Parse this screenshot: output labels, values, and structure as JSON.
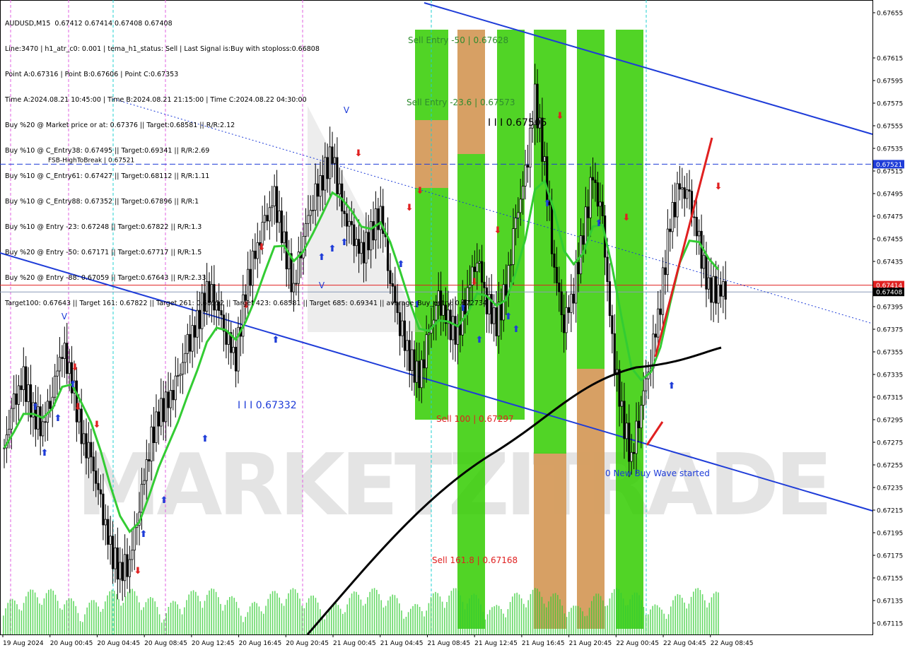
{
  "chart_data": {
    "type": "candlestick",
    "symbol": "AUDUSD,M15",
    "ohlc_header": "0.67412 0.67414 0.67408 0.67408",
    "info_lines": [
      "AUDUSD,M15  0.67412 0.67414 0.67408 0.67408",
      "Line:3470 | h1_atr_c0: 0.001 | tema_h1_status: Sell | Last Signal is:Buy with stoploss:0.66808",
      "Point A:0.67316 | Point B:0.67606 | Point C:0.67353",
      "Time A:2024.08.21 10:45:00 | Time B:2024.08.21 21:15:00 | Time C:2024.08.22 04:30:00",
      "Buy %20 @ Market price or at: 0.67376 || Target:0.68581 || R/R:2.12",
      "Buy %10 @ C_Entry38: 0.67495 || Target:0.69341 || R/R:2.69",
      "Buy %10 @ C_Entry61: 0.67427 || Target:0.68112 || R/R:1.11",
      "Buy %10 @ C_Entry88: 0.67352 || Target:0.67896 || R/R:1",
      "Buy %10 @ Entry -23: 0.67248 || Target:0.67822 || R/R:1.3",
      "Buy %20 @ Entry -50: 0.67171 || Target:0.67717 || R/R:1.5",
      "Buy %20 @ Entry -88: 0.67059 || Target:0.67643 || R/R:2.33",
      "Target100: 0.67643 || Target 161: 0.67822 || Target 261: 0.68112 || Target 423: 0.68581 || Target 685: 0.69341 || average_Buy_entry: 0.672734"
    ],
    "y_ticks": [
      "0.67655",
      "0.67615",
      "0.67595",
      "0.67575",
      "0.67555",
      "0.67535",
      "0.67515",
      "0.67495",
      "0.67475",
      "0.67455",
      "0.67435",
      "0.67395",
      "0.67375",
      "0.67355",
      "0.67335",
      "0.67315",
      "0.67295",
      "0.67275",
      "0.67255",
      "0.67235",
      "0.67215",
      "0.67195",
      "0.67175",
      "0.67155",
      "0.67135",
      "0.67115"
    ],
    "y_ticks_note": "",
    "y_range": [
      0.67105,
      0.67665
    ],
    "x_ticks": [
      "19 Aug 2024",
      "20 Aug 00:45",
      "20 Aug 04:45",
      "20 Aug 08:45",
      "20 Aug 12:45",
      "20 Aug 16:45",
      "20 Aug 20:45",
      "21 Aug 00:45",
      "21 Aug 04:45",
      "21 Aug 08:45",
      "21 Aug 12:45",
      "21 Aug 16:45",
      "21 Aug 20:45",
      "22 Aug 00:45",
      "22 Aug 04:45",
      "22 Aug 08:45"
    ],
    "price_badges": [
      {
        "label": "0.67521",
        "value": 0.67521,
        "color": "#1e3cd8"
      },
      {
        "label": "0.67414",
        "value": 0.67414,
        "color": "#e02020"
      },
      {
        "label": "0.67408",
        "value": 0.67408,
        "color": "#000000"
      }
    ],
    "horizontal_levels": [
      {
        "label": "FSB-HighToBreak | 0.67521",
        "value": 0.67521,
        "color": "#1e3cd8"
      },
      {
        "label": "",
        "value": 0.67414,
        "color": "#e02020"
      },
      {
        "label": "",
        "value": 0.67408,
        "color": "#8a9ab8"
      }
    ],
    "annotations": [
      {
        "text": "Sell Entry -50 | 0.67628",
        "value": 0.67628,
        "color": "#2e8b2e"
      },
      {
        "text": "Sell Entry -23.6 | 0.67573",
        "value": 0.67573,
        "color": "#2e8b2e"
      },
      {
        "text": "I I I 0.67505",
        "value": 0.67555,
        "color": "#000000"
      },
      {
        "text": "I I I 0.67332",
        "value": 0.67305,
        "color": "#1e3cd8"
      },
      {
        "text": "Sell 100 | 0.67297",
        "value": 0.67293,
        "color": "#e02020"
      },
      {
        "text": "Sell 161.8 | 0.67168",
        "value": 0.67168,
        "color": "#e02020"
      },
      {
        "text": "0 New Buy Wave started",
        "value": 0.67245,
        "color": "#1e3cd8"
      }
    ],
    "watermark": "MARKETZITRADE",
    "colors": {
      "bull_zone": "#33cc00",
      "bear_zone": "#e69a6c",
      "candles": "#000000",
      "ma_fast": "#33cc33",
      "ma_slow": "#000000",
      "channel": "#1e3cd8",
      "buy_arrow": "#1e3cd8",
      "sell_arrow": "#e02020",
      "volume": "#33cc33"
    },
    "series": [
      {
        "name": "",
        "values": [
          0.6727,
          0.6731,
          0.6733,
          0.673,
          0.6729,
          0.6732,
          0.6736,
          0.6733,
          0.6728,
          0.6726,
          0.6722,
          0.6718,
          0.6716,
          0.6717,
          0.6722,
          0.6727,
          0.673,
          0.6731,
          0.6733,
          0.6736,
          0.6738,
          0.6741,
          0.674,
          0.6737,
          0.6735,
          0.6741,
          0.6744,
          0.6747,
          0.6749,
          0.6745,
          0.6741,
          0.6746,
          0.6749,
          0.6751,
          0.6753,
          0.6748,
          0.6746,
          0.6744,
          0.6746,
          0.6748,
          0.6742,
          0.6738,
          0.6735,
          0.6733,
          0.6737,
          0.674,
          0.6738,
          0.6737,
          0.6741,
          0.6744,
          0.674,
          0.6738,
          0.6741,
          0.6747,
          0.6751,
          0.6758,
          0.6752,
          0.6743,
          0.6738,
          0.6741,
          0.6746,
          0.6751,
          0.6747,
          0.6736,
          0.673,
          0.6726,
          0.6731,
          0.6735,
          0.674,
          0.6747,
          0.675,
          0.6749,
          0.6745,
          0.6741,
          0.6741
        ]
      }
    ]
  }
}
